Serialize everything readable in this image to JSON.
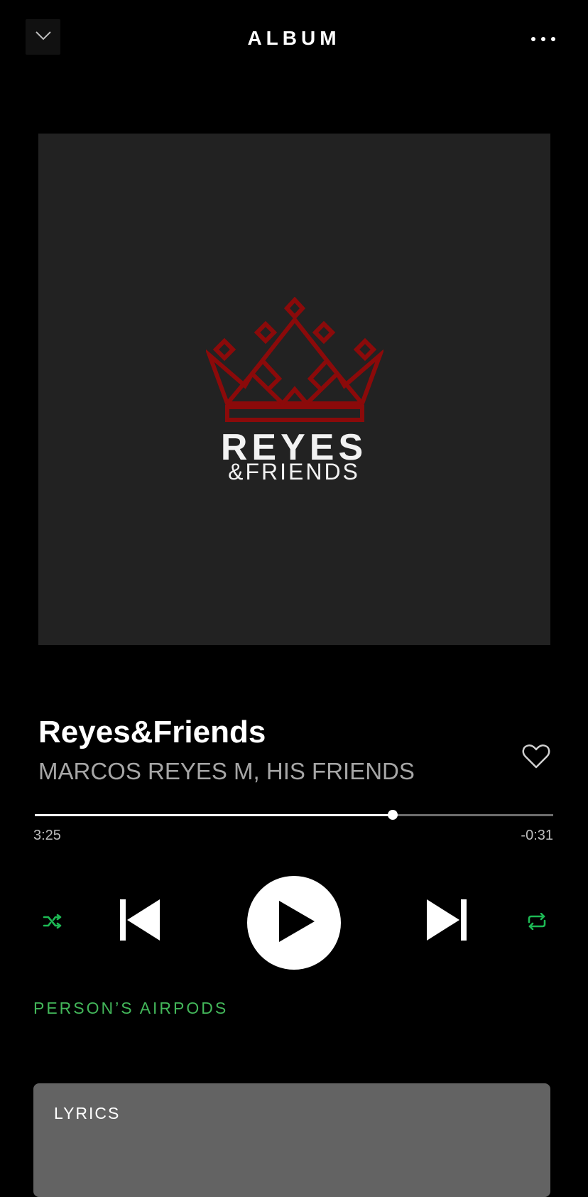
{
  "header": {
    "title": "ALBUM",
    "collapse_icon": "chevron-down-icon",
    "more_icon": "more-horizontal-icon"
  },
  "album_art": {
    "logo_main": "REYES",
    "logo_sub": "&FRIENDS",
    "logo_icon": "crown-icon",
    "logo_color": "#8b0a0a",
    "background": "#222222"
  },
  "track": {
    "title": "Reyes&Friends",
    "artist": "MARCOS REYES M, HIS FRIENDS",
    "like_icon": "heart-outline-icon"
  },
  "progress": {
    "elapsed": "3:25",
    "remaining": "-0:31",
    "fraction": 0.69
  },
  "controls": {
    "shuffle_icon": "shuffle-icon",
    "previous_icon": "skip-previous-icon",
    "play_icon": "play-icon",
    "next_icon": "skip-next-icon",
    "repeat_icon": "repeat-icon",
    "active_color": "#1db954"
  },
  "device": {
    "label": "PERSON’S AIRPODS",
    "color": "#43b75a"
  },
  "lyrics": {
    "title": "LYRICS"
  }
}
